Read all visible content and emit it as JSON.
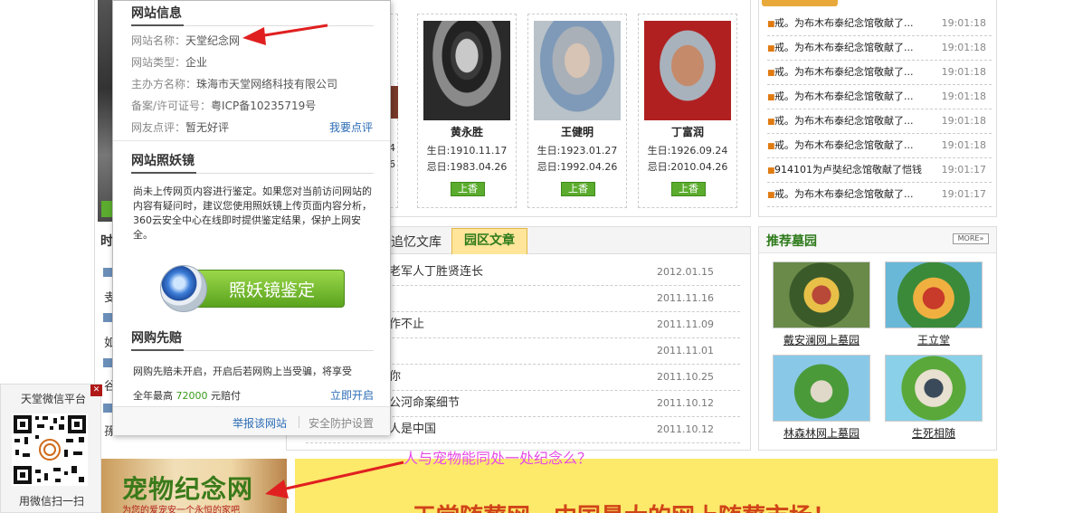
{
  "memorials": [
    {
      "name": "黄永胜",
      "birth": "生日:1910.11.17",
      "death": "忌日:1983.04.26",
      "button": "上香"
    },
    {
      "name": "王健明",
      "birth": "生日:1923.01.27",
      "death": "忌日:1992.04.26",
      "button": "上香"
    },
    {
      "name": "丁富润",
      "birth": "生日:1926.09.24",
      "death": "忌日:2010.04.26",
      "button": "上香"
    }
  ],
  "partial_dates": {
    "birth": "4",
    "death": "6"
  },
  "news": [
    {
      "title": "戒。为布木布泰纪念馆敬献了...",
      "time": "19:01:18"
    },
    {
      "title": "戒。为布木布泰纪念馆敬献了...",
      "time": "19:01:18"
    },
    {
      "title": "戒。为布木布泰纪念馆敬献了...",
      "time": "19:01:18"
    },
    {
      "title": "戒。为布木布泰纪念馆敬献了...",
      "time": "19:01:18"
    },
    {
      "title": "戒。为布木布泰纪念馆敬献了...",
      "time": "19:01:18"
    },
    {
      "title": "戒。为布木布泰纪念馆敬献了...",
      "time": "19:01:18"
    },
    {
      "title": "914101为卢奘纪念馆敬献了恺钱",
      "time": "19:01:17"
    },
    {
      "title": "戒。为布木布泰纪念馆敬献了...",
      "time": "19:01:17"
    }
  ],
  "tabs": {
    "memory_library": "追忆文库",
    "park_articles": "园区文章"
  },
  "articles": [
    {
      "title": "老军人丁胜贤连长",
      "date": "2012.01.15"
    },
    {
      "title": "",
      "date": "2011.11.16"
    },
    {
      "title": "作不止",
      "date": "2011.11.09"
    },
    {
      "title": "",
      "date": "2011.11.01"
    },
    {
      "title": "你",
      "date": "2011.10.25"
    },
    {
      "title": "公河命案细节",
      "date": "2011.10.12"
    },
    {
      "title": "人是中国",
      "date": "2011.10.12"
    }
  ],
  "recommended": {
    "title": "推荐墓园",
    "more": "MORE»",
    "items": [
      {
        "label": "戴安澜网上墓园"
      },
      {
        "label": "王立堂"
      },
      {
        "label": "林森林网上墓园"
      },
      {
        "label": "生死相随"
      }
    ]
  },
  "left_fragments": {
    "time_title": "时",
    "frag1": "叏",
    "frag2": "如",
    "frag3": "谷",
    "frag4": "孫"
  },
  "wechat": {
    "title": "天堂微信平台",
    "scan": "用微信扫一扫",
    "close": "✕"
  },
  "pet_banner": {
    "title": "宠物纪念网",
    "subtitle": "为您的爱宠安一个永恒的家吧"
  },
  "annotation": {
    "question": "人与宠物能同处一处纪念么？"
  },
  "yellow_banner": {
    "text": "天堂随葬网，中国最大的网上随葬市场！"
  },
  "popup": {
    "site_info_title": "网站信息",
    "site_name_label": "网站名称：",
    "site_name": "天堂纪念网",
    "site_type_label": "网站类型：",
    "site_type": "企业",
    "host_label": "主办方名称：",
    "host": "珠海市天堂网络科技有限公司",
    "icp_label": "备案/许可证号：",
    "icp": "粤ICP备10235719号",
    "review_label": "网友点评：",
    "review": "暂无好评",
    "review_link": "我要点评",
    "mirror_title": "网站照妖镜",
    "mirror_desc": "尚未上传网页内容进行鉴定。如果您对当前访问网站的内容有疑问时，建议您使用照妖镜上传页面内容分析，360云安全中心在线即时提供鉴定结果，保护上网安全。",
    "mirror_button": "照妖镜鉴定",
    "shopping_title": "网购先赔",
    "shopping_desc": "网购先赔未开启，开启后若网购上当受骗，将享受",
    "shopping_desc2": "全年最高",
    "shopping_amount": "72000",
    "shopping_desc3": "元赔付",
    "shopping_link": "立即开启",
    "report_link": "举报该网站",
    "settings_link": "安全防护设置"
  }
}
